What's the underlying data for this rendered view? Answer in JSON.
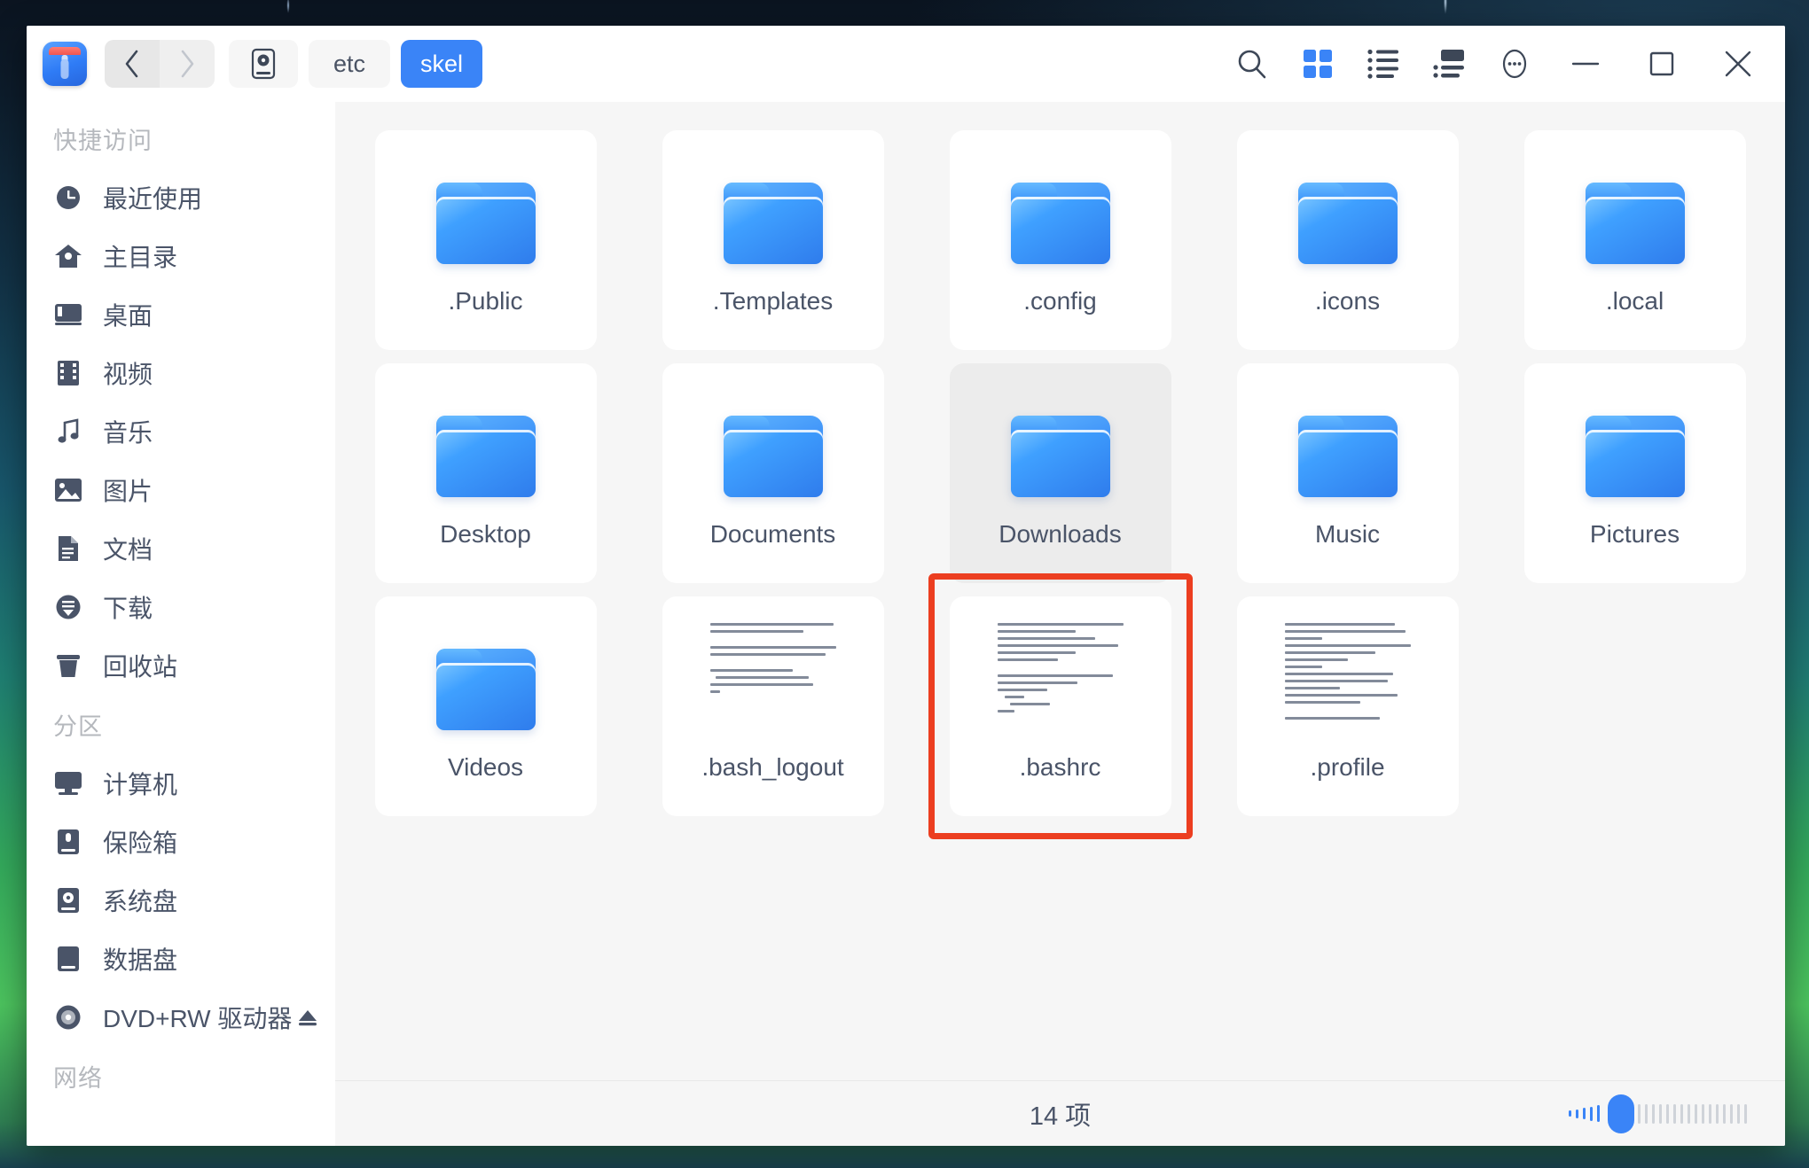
{
  "window": {
    "app_icon": "file-manager-icon",
    "nav": {
      "back": "back-icon",
      "forward": "forward-icon"
    },
    "breadcrumbs": [
      {
        "label": "",
        "icon": "system-disk-icon",
        "active": false
      },
      {
        "label": "etc",
        "icon": "",
        "active": false
      },
      {
        "label": "skel",
        "icon": "",
        "active": true
      }
    ],
    "toolbar_buttons": [
      {
        "name": "search-icon",
        "label": "search"
      },
      {
        "name": "grid-view-icon",
        "label": "grid view"
      },
      {
        "name": "list-view-icon",
        "label": "list view"
      },
      {
        "name": "detail-view-icon",
        "label": "detail view"
      },
      {
        "name": "more-options-icon",
        "label": "more"
      },
      {
        "name": "minimize-icon",
        "label": "minimize"
      },
      {
        "name": "maximize-icon",
        "label": "maximize"
      },
      {
        "name": "close-icon",
        "label": "close"
      }
    ],
    "accent_color": "#3a84f7",
    "annotation_color": "#ec3e20"
  },
  "sidebar": {
    "sections": [
      {
        "heading": "快捷访问",
        "items": [
          {
            "label": "最近使用",
            "icon": "clock-icon"
          },
          {
            "label": "主目录",
            "icon": "home-icon"
          },
          {
            "label": "桌面",
            "icon": "desktop-icon"
          },
          {
            "label": "视频",
            "icon": "film-icon"
          },
          {
            "label": "音乐",
            "icon": "music-note-icon"
          },
          {
            "label": "图片",
            "icon": "image-icon"
          },
          {
            "label": "文档",
            "icon": "document-icon"
          },
          {
            "label": "下载",
            "icon": "download-icon"
          },
          {
            "label": "回收站",
            "icon": "trash-icon"
          }
        ]
      },
      {
        "heading": "分区",
        "items": [
          {
            "label": "计算机",
            "icon": "computer-icon"
          },
          {
            "label": "保险箱",
            "icon": "safe-box-icon"
          },
          {
            "label": "系统盘",
            "icon": "system-disk-icon"
          },
          {
            "label": "数据盘",
            "icon": "data-disk-icon"
          },
          {
            "label": "DVD+RW 驱动器",
            "icon": "optical-disc-icon",
            "eject": "eject-icon"
          }
        ]
      },
      {
        "heading": "网络",
        "items": []
      }
    ]
  },
  "main": {
    "files": [
      {
        "name": ".Public",
        "type": "folder",
        "state": "normal"
      },
      {
        "name": ".Templates",
        "type": "folder",
        "state": "normal"
      },
      {
        "name": ".config",
        "type": "folder",
        "state": "normal"
      },
      {
        "name": ".icons",
        "type": "folder",
        "state": "normal"
      },
      {
        "name": ".local",
        "type": "folder",
        "state": "normal"
      },
      {
        "name": "Desktop",
        "type": "folder",
        "state": "normal"
      },
      {
        "name": "Documents",
        "type": "folder",
        "state": "normal"
      },
      {
        "name": "Downloads",
        "type": "folder",
        "state": "hovered"
      },
      {
        "name": "Music",
        "type": "folder",
        "state": "normal"
      },
      {
        "name": "Pictures",
        "type": "folder",
        "state": "normal"
      },
      {
        "name": "Videos",
        "type": "folder",
        "state": "normal"
      },
      {
        "name": ".bash_logout",
        "type": "text",
        "state": "normal"
      },
      {
        "name": ".bashrc",
        "type": "text",
        "state": "annotated"
      },
      {
        "name": ".profile",
        "type": "text",
        "state": "normal"
      }
    ]
  },
  "status": {
    "item_count": "14 项",
    "zoom_ticks_filled": 5,
    "zoom_ticks_total": 22
  }
}
